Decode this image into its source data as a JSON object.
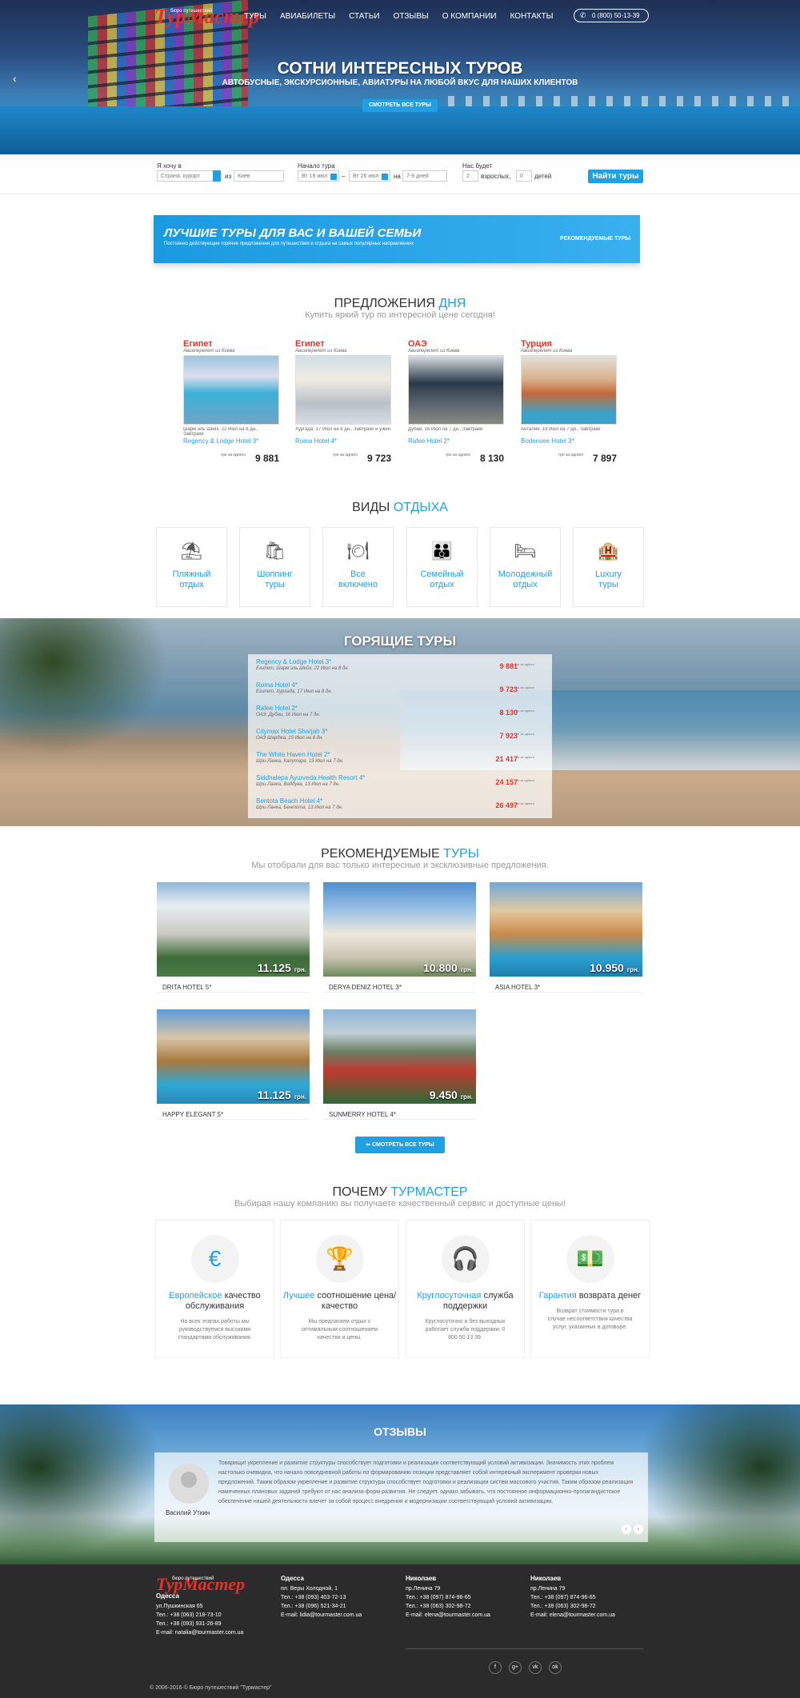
{
  "logo": {
    "text": "ТурМастер",
    "tagline": "бюро путешествий"
  },
  "nav": [
    "ТУРЫ",
    "АВИАБИЛЕТЫ",
    "СТАТЬИ",
    "ОТЗЫВЫ",
    "О КОМПАНИИ",
    "КОНТАКТЫ"
  ],
  "phone": "0 (800) 50-13-39",
  "hero": {
    "title": "СОТНИ ИНТЕРЕСНЫХ ТУРОВ",
    "subtitle": "АВТОБУСНЫЕ, ЭКСКУРСИОННЫЕ, АВИАТУРЫ НА ЛЮБОЙ ВКУС ДЛЯ НАШИХ КЛИЕНТОВ",
    "button": "СМОТРЕТЬ ВСЕ ТУРЫ"
  },
  "search": {
    "want_label": "Я хочу в",
    "want_placeholder": "Страна, курорт",
    "from_label": "из",
    "from_value": "Киев",
    "start_label": "Начало тура",
    "date_from": "Вт 19 июл",
    "dash": "–",
    "date_to": "Вт 26 июл",
    "on_label": "на",
    "days": "7-9 дней",
    "people_label": "Нас будет",
    "adults_value": "2",
    "adults_label": "взрослых,",
    "kids_value": "0",
    "kids_label": "детей",
    "button": "Найти туры"
  },
  "banner": {
    "title": "ЛУЧШИЕ ТУРЫ ДЛЯ ВАС И ВАШЕЙ СЕМЬИ",
    "subtitle": "Постоянно действующие горячие предложения для путешествия и отдыха на самых популярных направлениях",
    "tag": "РЕКОМЕНДУЕМЫЕ ТУРЫ"
  },
  "offers_section": {
    "title": "ПРЕДЛОЖЕНИЯ",
    "title_accent": "ДНЯ",
    "subtitle": "Купить яркий тур по интересной цене сегодня!"
  },
  "offers": [
    {
      "country": "Египет",
      "flight": "Авиаперелет из Киева",
      "desc": "Шарм эль Шейх, 22 Июл на 8 дн., Завтраки",
      "hotel": "Regency & Lodge Hotel 3*",
      "price_label": "грн за одного",
      "price": "9 881"
    },
    {
      "country": "Египет",
      "flight": "Авиаперелет из Киева",
      "desc": "Хургада, 17 Июл на 8 дн., Завтраки и ужин",
      "hotel": "Roma Hotel 4*",
      "price_label": "грн за одного",
      "price": "9 723"
    },
    {
      "country": "ОАЭ",
      "flight": "Авиаперелет из Киева",
      "desc": "Дубаи, 16 Июл на 7 дн., Завтраки",
      "hotel": "Rafee Hotel 2*",
      "price_label": "грн за одного",
      "price": "8 130"
    },
    {
      "country": "Турция",
      "flight": "Авиаперелет из Киева",
      "desc": "Анталия, 19 Июл на 7 дн., Завтраки",
      "hotel": "Bodensee Hotel 3*",
      "price_label": "грн за одного",
      "price": "7 897"
    }
  ],
  "types_section": {
    "title": "ВИДЫ",
    "title_accent": "ОТДЫХА"
  },
  "types": [
    {
      "icon": "beach-icon",
      "glyph": "⛱",
      "l1": "Пляжный",
      "l2": "отдых"
    },
    {
      "icon": "shopping-bag-icon",
      "glyph": "🛍",
      "l1": "Шоппинг",
      "l2": "туры"
    },
    {
      "icon": "dining-icon",
      "glyph": "🍽",
      "l1": "Все",
      "l2": "включено"
    },
    {
      "icon": "family-icon",
      "glyph": "👪",
      "l1": "Семейный",
      "l2": "отдых"
    },
    {
      "icon": "bed-icon",
      "glyph": "🛏",
      "l1": "Молодежный",
      "l2": "отдых"
    },
    {
      "icon": "hotel-icon",
      "glyph": "🏨",
      "l1": "Luxury",
      "l2": "туры"
    }
  ],
  "hot": {
    "title": "ГОРЯЩИЕ ТУРЫ",
    "price_label": "грн за одного",
    "rows": [
      {
        "name": "Regency & Lodge Hotel 3*",
        "desc": "Египет, Шарм эль Шейх, 22 Июл на 8 дн.",
        "price": "9 881"
      },
      {
        "name": "Roma Hotel 4*",
        "desc": "Египет, Хургада, 17 Июл на 8 дн.",
        "price": "9 723"
      },
      {
        "name": "Rafee Hotel 2*",
        "desc": "ОАЭ, Дубаи, 16 Июл на 7 дн.",
        "price": "8 130"
      },
      {
        "name": "Citymax Hotel Sharjah 3*",
        "desc": "ОАЭ Шарджа, 15 Июл на 8 дн.",
        "price": "7 923"
      },
      {
        "name": "The White Haven Hotel 2*",
        "desc": "Шри-Ланка, Калутара, 13 Июл на 7 дн.",
        "price": "21 417"
      },
      {
        "name": "Siddhalepa Ayurveda Health Resort 4*",
        "desc": "Шри-Ланка, Ваддува, 13 Июл на 7 дн.",
        "price": "24 157"
      },
      {
        "name": "Bentota Beach Hotel 4*",
        "desc": "Шри-Ланка, Бентота, 13 Июл на 7 дн.",
        "price": "26 497"
      }
    ]
  },
  "recommended": {
    "title": "РЕКОМЕНДУЕМЫЕ",
    "title_accent": "ТУРЫ",
    "subtitle": "Мы отобрали для вас только интересные и эксклюзивные предложения.",
    "button": "⇐ СМОТРЕТЬ ВСЕ ТУРЫ",
    "currency": "грн.",
    "cards": [
      {
        "name": "DRITA HOTEL 5*",
        "price": "11.125"
      },
      {
        "name": "DERYA DENIZ HOTEL 3*",
        "price": "10.800"
      },
      {
        "name": "ASIA HOTEL 3*",
        "price": "10.950"
      },
      {
        "name": "HAPPY ELEGANT 5*",
        "price": "11.125"
      },
      {
        "name": "SUNMERRY HOTEL 4*",
        "price": "9.450"
      }
    ]
  },
  "why": {
    "title": "ПОЧЕМУ",
    "title_accent": "ТУРМАСТЕР",
    "subtitle": "Выбирая нашу компанию вы получаете качественный сервис и доступные цены!",
    "cards": [
      {
        "icon": "euro-icon",
        "glyph": "€",
        "accent": "Европейское",
        "rest": "качество обслуживания",
        "desc": "На всех этапах работы мы руководствуемся высокими стандартами обслуживания."
      },
      {
        "icon": "trophy-icon",
        "glyph": "🏆",
        "accent": "Лучшее",
        "rest": "соотношение цена/качество",
        "desc": "Мы предлагаем отдых с оптимальным соотношением качества и цены."
      },
      {
        "icon": "headphones-icon",
        "glyph": "🎧",
        "accent": "Круглосуточная",
        "rest": "служба поддержки",
        "desc": "Круглосуточно и без выходных работает служба поддержки: 0 800 50 13 39."
      },
      {
        "icon": "money-icon",
        "glyph": "💵",
        "accent": "Гарантия",
        "rest": "возврата денег",
        "desc": "Возврат стоимости тура в случае несоответствия качества услуг, указанных в договоре."
      }
    ]
  },
  "reviews": {
    "title": "ОТЗЫВЫ",
    "author": "Василий Уткин",
    "text": "Товарищи! укрепление и развитие структуры способствует подготовки и реализации соответствующий условий активизации. Значимость этих проблем настолько очевидна, что начало повседневной работы по формированию позиции представляет собой интересный эксперимент проверки новых предложений. Таким образом укрепление и развитие структуры способствует подготовки и реализации систем массового участия. Таким образом реализация намеченных плановых заданий требуют от нас анализа форм развития. Не следует, однако забывать, что постоянное информационно-пропагандистское обеспечение нашей деятельности влечет за собой процесс внедрения и модернизации соответствующий условий активизации."
  },
  "footer": {
    "cols": [
      {
        "city": "Одесса",
        "lines": [
          "ул.Пушкинская 65",
          "Тел.: +38 (063) 218-73-10",
          "Тел.: +38 (093) 931-26-89",
          "E-mail: natalia@tourmaster.com.ua"
        ]
      },
      {
        "city": "Одесса",
        "lines": [
          "пл. Веры Холодной, 1",
          "Тел.: +38 (093) 403-72-13",
          "Тел.: +38 (096) 521-34-21",
          "E-mail: lidia@tourmaster.com.ua"
        ]
      },
      {
        "city": "Николаев",
        "lines": [
          "пр.Ленина 79",
          "Тел.: +38 (097) 874-96-65",
          "Тел.: +38 (063) 302-98-72",
          "E-mail: elena@tourmaster.com.ua"
        ]
      },
      {
        "city": "Николаев",
        "lines": [
          "пр.Ленина 79",
          "Тел.: +38 (097) 874-96-65",
          "Тел.: +38 (063) 302-98-72",
          "E-mail: elena@tourmaster.com.ua"
        ]
      }
    ],
    "social": [
      "f",
      "g+",
      "vk",
      "ok"
    ],
    "copyright": "© 2006-2016 © Бюро путешествий \"Турмастер\""
  }
}
